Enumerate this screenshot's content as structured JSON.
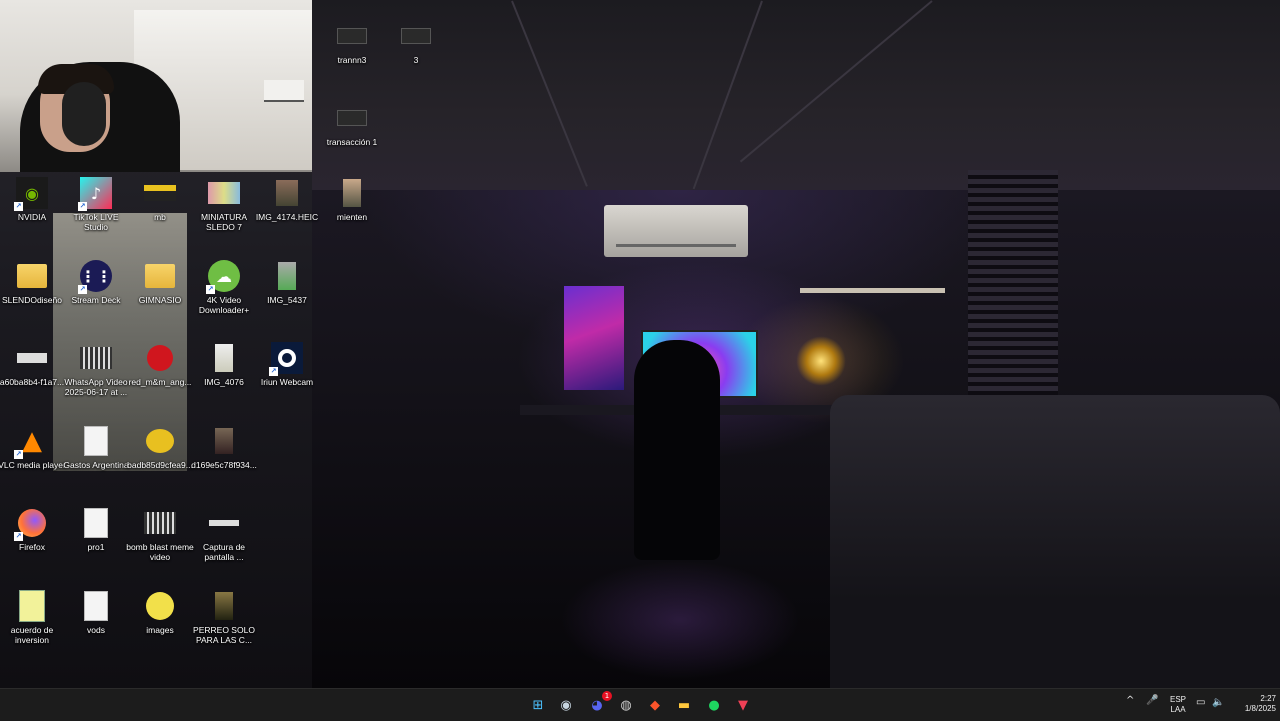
{
  "desktop": {
    "icons": [
      {
        "label": "trannn3",
        "icon": "file-icon"
      },
      {
        "label": "3",
        "icon": "file-icon"
      },
      {
        "label": "transacción 1",
        "icon": "file-icon"
      },
      {
        "label": "NVIDIA",
        "icon": "nvidia-icon"
      },
      {
        "label": "TikTok LIVE Studio",
        "icon": "tiktok-icon"
      },
      {
        "label": "mb",
        "icon": "image-icon"
      },
      {
        "label": "MINIATURA SLEDO 7",
        "icon": "image-icon"
      },
      {
        "label": "IMG_4174.HEIC",
        "icon": "image-icon"
      },
      {
        "label": "mienten",
        "icon": "image-icon"
      },
      {
        "label": "SLENDOdiseño",
        "icon": "folder-icon"
      },
      {
        "label": "Stream Deck",
        "icon": "stream-deck-icon"
      },
      {
        "label": "GIMNASIO",
        "icon": "folder-icon"
      },
      {
        "label": "4K Video Downloader+",
        "icon": "download-icon"
      },
      {
        "label": "IMG_5437",
        "icon": "image-icon"
      },
      {
        "label": "a60ba8b4-f1a7...",
        "icon": "image-icon"
      },
      {
        "label": "WhatsApp Video 2025-06-17 at ...",
        "icon": "video-icon"
      },
      {
        "label": "red_m&m_ang...",
        "icon": "image-icon"
      },
      {
        "label": "IMG_4076",
        "icon": "image-icon"
      },
      {
        "label": "Iriun Webcam",
        "icon": "webcam-icon"
      },
      {
        "label": "VLC media player",
        "icon": "vlc-icon"
      },
      {
        "label": "Gastos Argentina",
        "icon": "document-icon"
      },
      {
        "label": "badb85d9cfea9...",
        "icon": "image-icon"
      },
      {
        "label": "d169e5c78f934...",
        "icon": "image-icon"
      },
      {
        "label": "Firefox",
        "icon": "firefox-icon"
      },
      {
        "label": "pro1",
        "icon": "document-icon"
      },
      {
        "label": "bomb blast meme video",
        "icon": "video-icon"
      },
      {
        "label": "Captura de pantalla ...",
        "icon": "image-icon"
      },
      {
        "label": "acuerdo de inversion",
        "icon": "document-icon"
      },
      {
        "label": "vods",
        "icon": "document-icon"
      },
      {
        "label": "images",
        "icon": "image-icon"
      },
      {
        "label": "PERREO SOLO PARA LAS C...",
        "icon": "image-icon"
      }
    ]
  },
  "taskbar": {
    "apps": [
      {
        "name": "start-button",
        "glyph": "⊞",
        "color": "#4cc2ff"
      },
      {
        "name": "steam",
        "glyph": "◉",
        "color": "#c7d5e0"
      },
      {
        "name": "discord",
        "glyph": "◕",
        "color": "#5865f2",
        "badge": "1"
      },
      {
        "name": "obs",
        "glyph": "◍",
        "color": "#cfcfcf"
      },
      {
        "name": "brave",
        "glyph": "◆",
        "color": "#fb542b"
      },
      {
        "name": "file-explorer",
        "glyph": "▬",
        "color": "#ffc83d"
      },
      {
        "name": "spotify",
        "glyph": "●",
        "color": "#1ed760"
      },
      {
        "name": "pocket",
        "glyph": "▼",
        "color": "#ef4056"
      }
    ],
    "tray": {
      "chevron": "^",
      "mic": "🎤",
      "lang_top": "ESP",
      "lang_bottom": "LAA",
      "time": "2:27",
      "date": "1/8/2025"
    }
  }
}
